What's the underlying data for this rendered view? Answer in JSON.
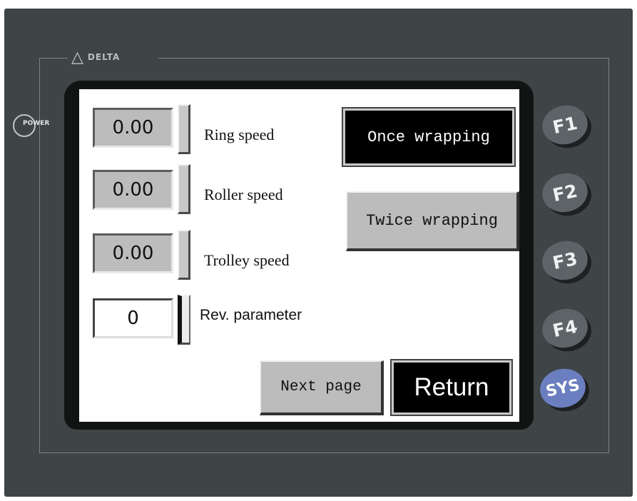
{
  "device": {
    "brand_logo": "DELTA",
    "power_label": "POWER",
    "function_keys": [
      "F1",
      "F2",
      "F3",
      "F4",
      "SYS"
    ]
  },
  "screen": {
    "ring_speed": {
      "value": "0.00",
      "label": "Ring speed"
    },
    "roller_speed": {
      "value": "0.00",
      "label": "Roller speed"
    },
    "trolley_speed": {
      "value": "0.00",
      "label": "Trolley speed"
    },
    "rev_parameter": {
      "value": "0",
      "label": "Rev. parameter"
    },
    "buttons": {
      "once_wrapping": "Once wrapping",
      "twice_wrapping": "Twice wrapping",
      "next_page": "Next page",
      "return": "Return"
    }
  },
  "colors": {
    "device_body": "#3f4446",
    "bezel": "#121414",
    "field_gray": "#bcbcbc",
    "sys_key": "#6b7fc0"
  }
}
